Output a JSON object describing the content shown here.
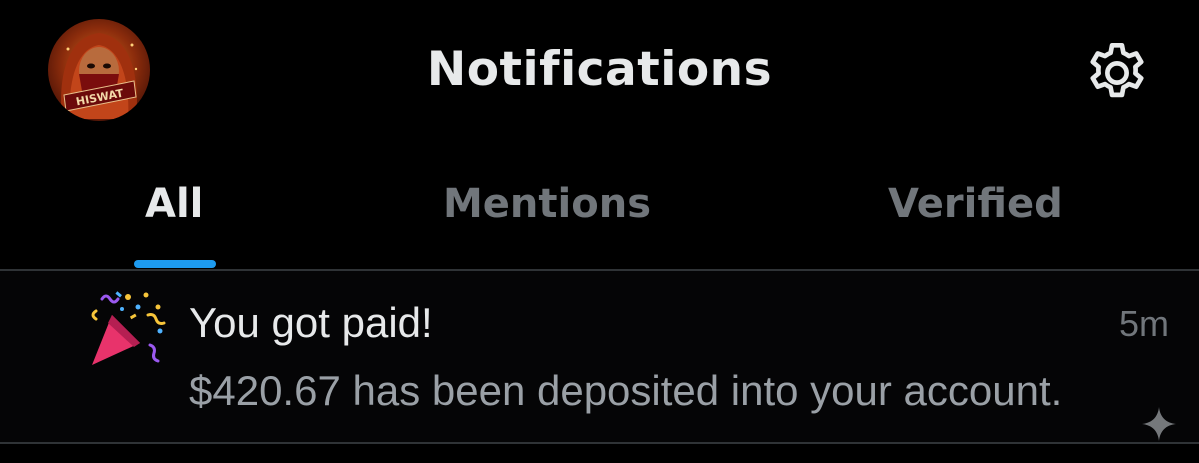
{
  "header": {
    "title": "Notifications",
    "avatar_text": "HISWAT",
    "avatar_icon": "avatar",
    "settings_icon": "gear-icon"
  },
  "tabs": [
    {
      "label": "All",
      "active": true
    },
    {
      "label": "Mentions",
      "active": false
    },
    {
      "label": "Verified",
      "active": false
    }
  ],
  "notifications": [
    {
      "icon": "party-popper-icon",
      "title": "You got paid!",
      "time": "5m",
      "body": "$420.67 has been deposited into your account."
    }
  ],
  "colors": {
    "background": "#000000",
    "text_primary": "#e7e9ea",
    "text_secondary": "#71767b",
    "accent": "#1d9bf0",
    "divider": "#2f3336"
  }
}
